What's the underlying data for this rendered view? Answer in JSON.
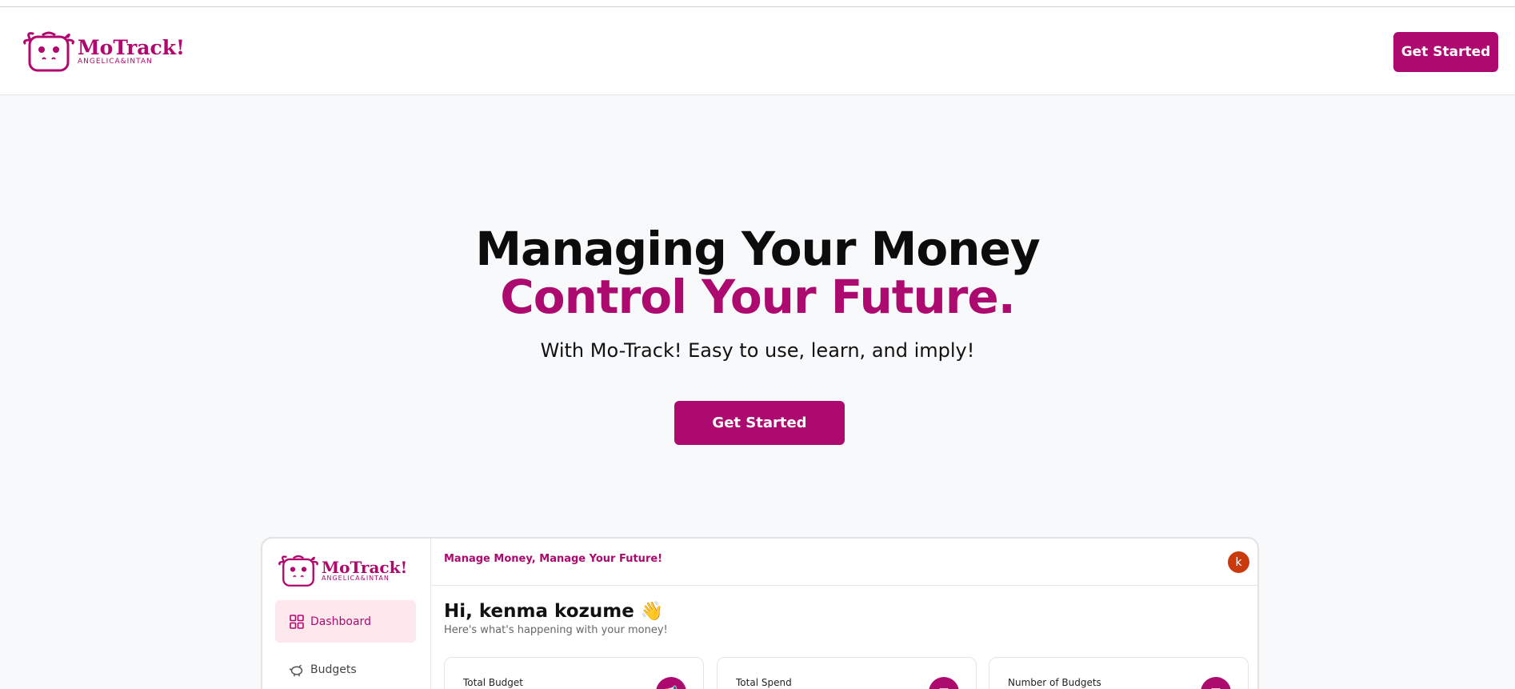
{
  "header": {
    "logo": {
      "name": "MoTrack!",
      "sub": "ANGELICA&INTAN",
      "icon": "cow-face-logo"
    },
    "cta_label": "Get Started"
  },
  "hero": {
    "title_line1": "Managing Your Money",
    "title_line2": "Control Your Future.",
    "subtitle": "With Mo-Track! Easy to use, learn, and imply!",
    "cta_label": "Get Started"
  },
  "preview": {
    "sidebar": {
      "logo": {
        "name": "MoTrack!",
        "sub": "ANGELICA&INTAN"
      },
      "items": [
        {
          "label": "Dashboard",
          "icon": "grid-icon",
          "active": true
        },
        {
          "label": "Budgets",
          "icon": "piggy-bank-icon",
          "active": false
        }
      ]
    },
    "topbar": {
      "tagline": "Manage Money, Manage Your Future!",
      "avatar_initial": "k"
    },
    "greeting": "Hi, kenma kozume 👋",
    "greeting_sub": "Here's what's happening with your money!",
    "cards": [
      {
        "label": "Total Budget",
        "icon": "megaphone-icon"
      },
      {
        "label": "Total Spend",
        "icon": "receipt-icon"
      },
      {
        "label": "Number of Budgets",
        "icon": "wallet-icon"
      }
    ]
  },
  "colors": {
    "brand": "#ad0a70",
    "avatar": "#c93b0f",
    "active_nav_bg": "#fde8ee"
  }
}
